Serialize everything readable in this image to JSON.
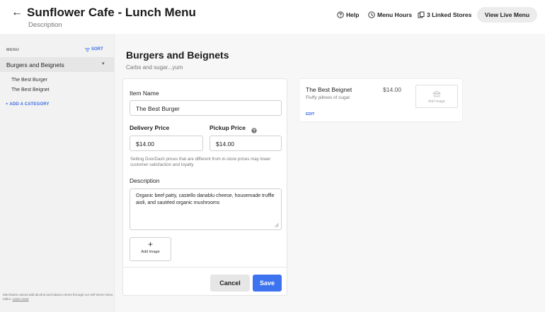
{
  "header": {
    "back_glyph": "←",
    "title": "Sunflower Cafe - Lunch Menu",
    "subtitle": "Description",
    "help_label": "Help",
    "menu_hours_label": "Menu Hours",
    "linked_stores_label": "3 Linked Stores",
    "view_live_label": "View Live Menu"
  },
  "sidebar": {
    "menu_label": "MENU",
    "sort_label": "SORT",
    "category": "Burgers and Beignets",
    "items": [
      "The Best Burger",
      "The Best Beignet"
    ],
    "add_category_label": "+ ADD A CATEGORY",
    "footnote": "Merchants cannot add alcohol and tobacco items through our self-serve menu editor.",
    "learn_more": "Learn more"
  },
  "section": {
    "title": "Burgers and Beignets",
    "description": "Carbs and sugar...yum"
  },
  "edit_form": {
    "item_name_label": "Item Name",
    "item_name_value": "The  Best Burger",
    "delivery_price_label": "Delivery Price",
    "delivery_price_value": "$14.00",
    "pickup_price_label": "Pickup Price",
    "pickup_price_value": "$14.00",
    "helper_text": "Setting DoorDash prices that are different from in-store prices may lower customer satisfaction and loyalty",
    "description_label": "Description",
    "description_value": "Organic beef patty, castello danablu cheese, housemade truffle aioli, and sautéed organic mushrooms",
    "add_image_plus": "+",
    "add_image_label": "Add image",
    "cancel_label": "Cancel",
    "save_label": "Save"
  },
  "item_card": {
    "name": "The Best Beignet",
    "description": "Fluffy pillows of sugar",
    "price": "$14.00",
    "edit_label": "EDIT",
    "add_image_label": "Add image"
  },
  "colors": {
    "accent": "#3d73ef",
    "link": "#3b6ee6",
    "canvas": "#f7f7f7",
    "sidebar": "#f2f2f2"
  },
  "icons": [
    "back-arrow-icon",
    "help-icon",
    "clock-icon",
    "stores-icon",
    "sort-icon",
    "caret-down-icon",
    "info-icon",
    "resize-handle-icon",
    "image-placeholder-icon"
  ]
}
